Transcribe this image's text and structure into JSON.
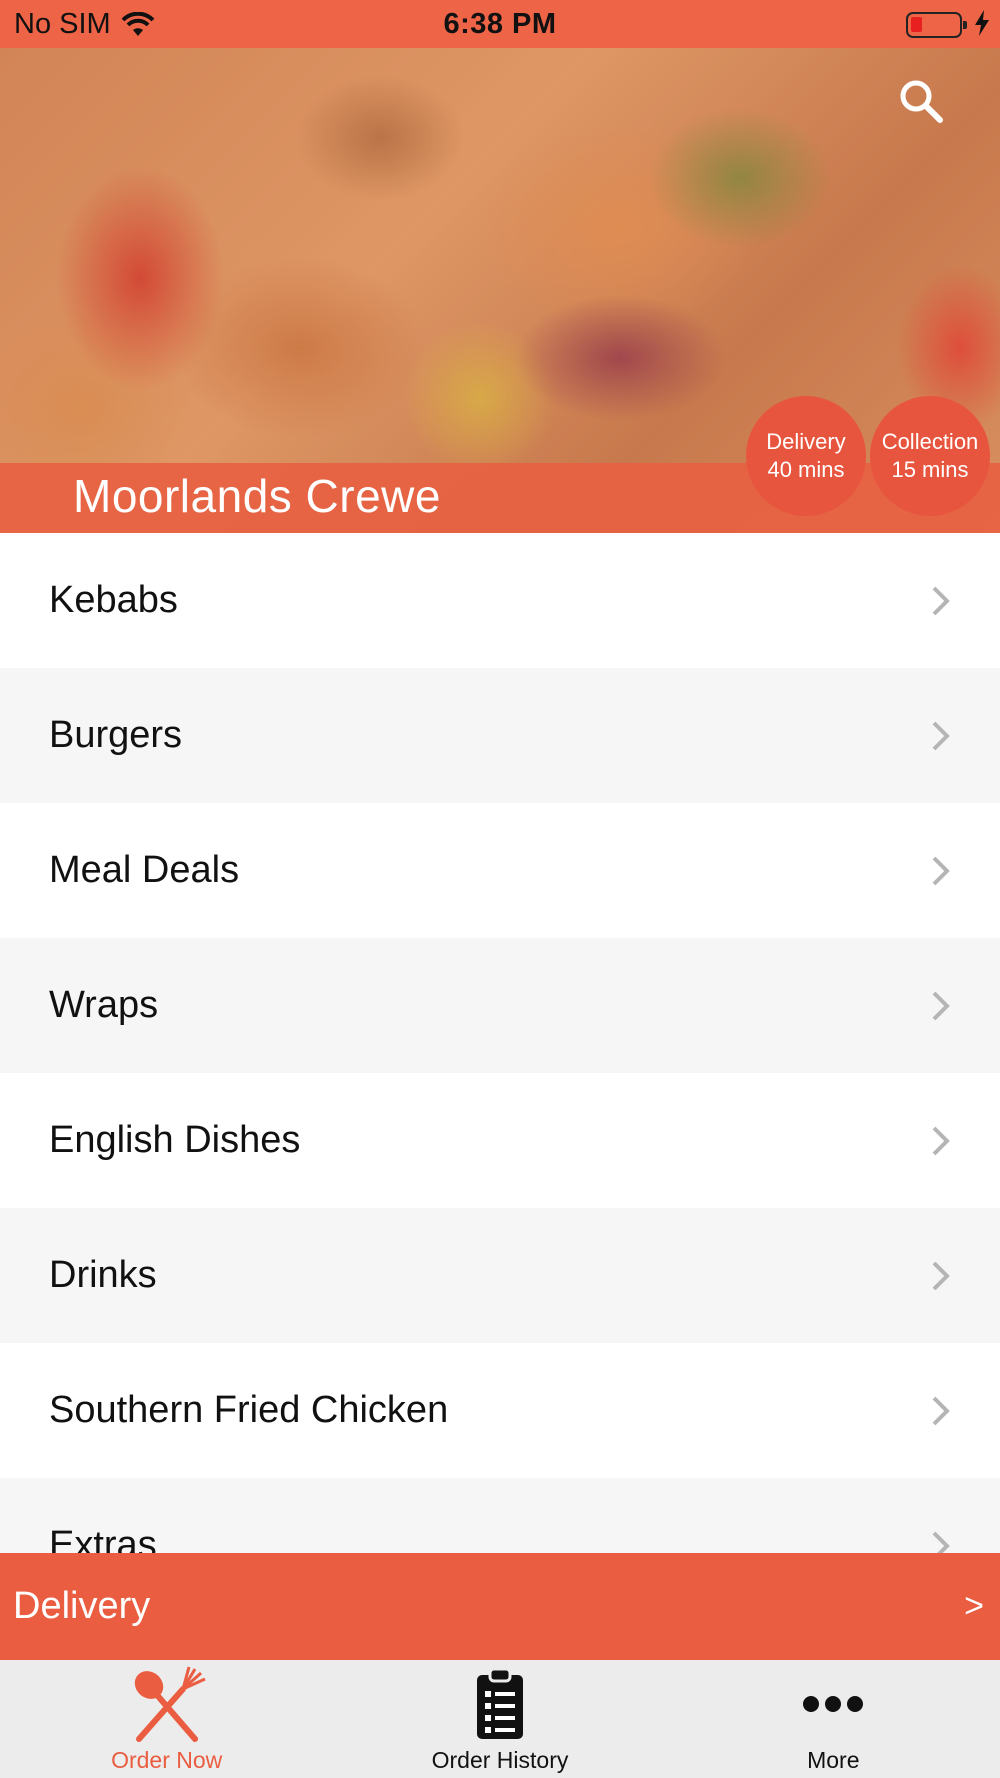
{
  "status_bar": {
    "carrier": "No SIM",
    "time": "6:38 PM"
  },
  "header": {
    "restaurant_name": "Moorlands Crewe",
    "delivery": {
      "label": "Delivery",
      "time": "40 mins"
    },
    "collection": {
      "label": "Collection",
      "time": "15 mins"
    }
  },
  "menu": {
    "items": [
      {
        "label": "Kebabs"
      },
      {
        "label": "Burgers"
      },
      {
        "label": "Meal Deals"
      },
      {
        "label": "Wraps"
      },
      {
        "label": "English Dishes"
      },
      {
        "label": "Drinks"
      },
      {
        "label": "Southern Fried Chicken"
      },
      {
        "label": "Extras"
      }
    ]
  },
  "delivery_bar": {
    "label": "Delivery",
    "arrow": ">"
  },
  "tabs": [
    {
      "label": "Order Now",
      "icon": "fork-knife-icon",
      "active": true
    },
    {
      "label": "Order History",
      "icon": "clipboard-icon",
      "active": false
    },
    {
      "label": "More",
      "icon": "more-dots-icon",
      "active": false
    }
  ],
  "colors": {
    "accent": "#ea5d40",
    "status_bar": "#ee6447",
    "tab_bar": "#ececec",
    "row_alt": "#f6f6f6"
  }
}
